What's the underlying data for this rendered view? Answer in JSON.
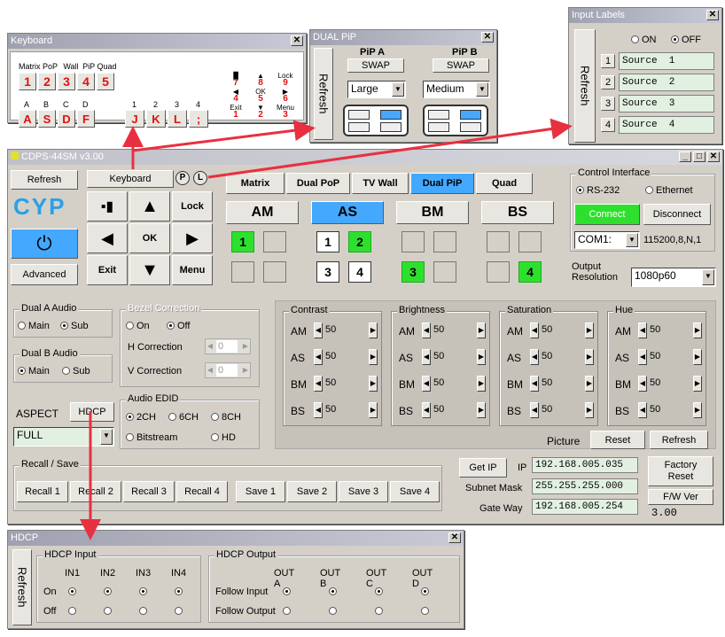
{
  "keyboard": {
    "title": "Keyboard",
    "modes": [
      "Matrix",
      "PoP",
      "Wall",
      "PiP",
      "Quad"
    ],
    "num_keys": [
      "1",
      "2",
      "3",
      "4",
      "5"
    ],
    "out_heads": [
      "A",
      "B",
      "C",
      "D"
    ],
    "out_keys": [
      "A",
      "S",
      "D",
      "F"
    ],
    "right_heads": [
      "1",
      "2",
      "3",
      "4"
    ],
    "right_keys": [
      "J",
      "K",
      "L",
      ";"
    ],
    "pad": [
      [
        "▐▌",
        "7"
      ],
      [
        "▲",
        "8"
      ],
      [
        "Lock",
        "9"
      ],
      [
        "◀",
        "4"
      ],
      [
        "OK",
        "5"
      ],
      [
        "▶",
        "6"
      ],
      [
        "Exit",
        "1"
      ],
      [
        "▼",
        "2"
      ],
      [
        "Menu",
        "3"
      ]
    ]
  },
  "dualpip": {
    "title": "DUAL PiP",
    "refresh": "Refresh",
    "pip_a": "PiP A",
    "pip_b": "PiP B",
    "swap": "SWAP",
    "size_a": "Large",
    "size_b": "Medium"
  },
  "inputlabels": {
    "title": "Input Labels",
    "refresh": "Refresh",
    "on": "ON",
    "off": "OFF",
    "items": [
      [
        "1",
        "Source  1"
      ],
      [
        "2",
        "Source  2"
      ],
      [
        "3",
        "Source  3"
      ],
      [
        "4",
        "Source  4"
      ]
    ]
  },
  "main": {
    "title": "CDPS-44SM v3.00",
    "refresh": "Refresh",
    "keyboard_btn": "Keyboard",
    "p_btn": "P",
    "l_btn": "L",
    "logo": "CYP",
    "advanced": "Advanced",
    "nav": {
      "lock": "Lock",
      "ok": "OK",
      "exit": "Exit",
      "menu": "Menu"
    },
    "modes": [
      "Matrix",
      "Dual PoP",
      "TV Wall",
      "Dual PiP",
      "Quad"
    ],
    "active_mode": "Dual PiP",
    "outputs": [
      "AM",
      "AS",
      "BM",
      "BS"
    ],
    "control_interface": {
      "label": "Control Interface",
      "rs232": "RS-232",
      "ethernet": "Ethernet",
      "connect": "Connect",
      "disconnect": "Disconnect",
      "port": "COM1:",
      "settings": "115200,8,N,1"
    },
    "output_resolution": {
      "label1": "Output",
      "label2": "Resolution",
      "value": "1080p60"
    },
    "dual_a_audio": {
      "label": "Dual A Audio",
      "main": "Main",
      "sub": "Sub"
    },
    "dual_b_audio": {
      "label": "Dual B Audio",
      "main": "Main",
      "sub": "Sub"
    },
    "bezel": {
      "label": "Bezel Correction",
      "on": "On",
      "off": "Off",
      "h": "H Correction",
      "v": "V Correction",
      "h_val": "0",
      "v_val": "0"
    },
    "aspect": {
      "label": "ASPECT",
      "hdcp": "HDCP",
      "value": "FULL"
    },
    "audio_edid": {
      "label": "Audio EDID",
      "o1": "2CH",
      "o2": "6CH",
      "o3": "8CH",
      "o4": "Bitstream",
      "o5": "HD"
    },
    "picture": {
      "groups": [
        "Contrast",
        "Brightness",
        "Saturation",
        "Hue"
      ],
      "rows": [
        "AM",
        "AS",
        "BM",
        "BS"
      ],
      "value": "50",
      "label": "Picture",
      "reset": "Reset",
      "refresh": "Refresh"
    },
    "recall_save": {
      "label": "Recall / Save",
      "recall": [
        "Recall 1",
        "Recall 2",
        "Recall 3",
        "Recall 4"
      ],
      "save": [
        "Save 1",
        "Save 2",
        "Save 3",
        "Save 4"
      ]
    },
    "network": {
      "get_ip": "Get IP",
      "ip_label": "IP",
      "ip": "192.168.005.035",
      "mask_label": "Subnet Mask",
      "mask": "255.255.255.000",
      "gw_label": "Gate Way",
      "gw": "192.168.005.254",
      "factory1": "Factory",
      "factory2": "Reset",
      "fw": "F/W Ver",
      "fw_val": "3.00"
    }
  },
  "hdcp": {
    "title": "HDCP",
    "refresh": "Refresh",
    "input_label": "HDCP Input",
    "inputs": [
      "IN1",
      "IN2",
      "IN3",
      "IN4"
    ],
    "on": "On",
    "off": "Off",
    "output_label": "HDCP Output",
    "outputs": [
      "OUT A",
      "OUT B",
      "OUT C",
      "OUT D"
    ],
    "follow_input": "Follow Input",
    "follow_output": "Follow Output"
  },
  "colors": {
    "arrow": "#e83040",
    "active": "#2ee02e",
    "selected_tab": "#44a8ff"
  }
}
